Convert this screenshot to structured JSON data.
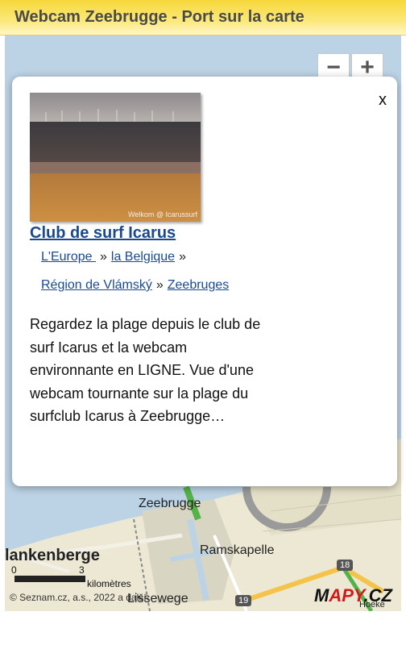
{
  "header": {
    "title": "Webcam Zeebrugge - Port sur la carte"
  },
  "map": {
    "zoom_out": "−",
    "zoom_in": "+",
    "labels": {
      "zeebrugge": "Zeebrugge",
      "blankenberge": "lankenberge",
      "ramskapelle": "Ramskapelle",
      "lissewege": "Lissewege",
      "hoeke": "Hoeke",
      "road_18": "18",
      "road_19": "19"
    },
    "scale": {
      "zero": "0",
      "three": "3",
      "unit": "kilomètres"
    },
    "copyright": "© Seznam.cz, a.s., 2022 a další",
    "logo": {
      "prefix": "M",
      "mid": "APY",
      "suffix": ".CZ"
    }
  },
  "popup": {
    "close": "x",
    "thumbnail_caption": "Welkom @ Icarussurf",
    "title": "Club de surf Icarus",
    "breadcrumb": {
      "europe": "L'Europe ",
      "belgium": "la Belgique",
      "region": "Région de Vlámský",
      "city": "Zeebruges",
      "separator": "»"
    },
    "description": "Regardez la plage depuis le club de surf Icarus et la webcam environnante en LIGNE. Vue d'une webcam tournante sur la plage du surfclub Icarus à Zeebrugge…"
  }
}
